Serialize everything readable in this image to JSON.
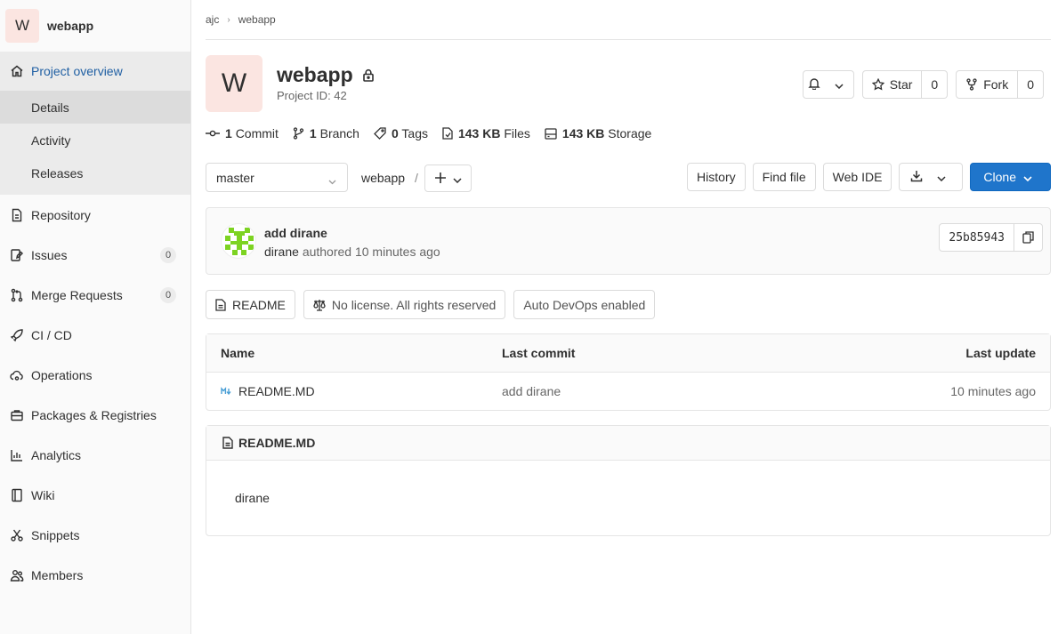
{
  "sidebar": {
    "project_initial": "W",
    "project_name": "webapp",
    "overview_label": "Project overview",
    "sub_items": [
      "Details",
      "Activity",
      "Releases"
    ],
    "items": [
      {
        "label": "Repository"
      },
      {
        "label": "Issues",
        "count": "0"
      },
      {
        "label": "Merge Requests",
        "count": "0"
      },
      {
        "label": "CI / CD"
      },
      {
        "label": "Operations"
      },
      {
        "label": "Packages & Registries"
      },
      {
        "label": "Analytics"
      },
      {
        "label": "Wiki"
      },
      {
        "label": "Snippets"
      },
      {
        "label": "Members"
      }
    ]
  },
  "breadcrumb": [
    "ajc",
    "webapp"
  ],
  "header": {
    "initial": "W",
    "title": "webapp",
    "project_id": "Project ID: 42",
    "star_label": "Star",
    "star_count": "0",
    "fork_label": "Fork",
    "fork_count": "0"
  },
  "stats": {
    "commits_num": "1",
    "commits_label": "Commit",
    "branches_num": "1",
    "branches_label": "Branch",
    "tags_num": "0",
    "tags_label": "Tags",
    "files_num": "143 KB",
    "files_label": "Files",
    "storage_num": "143 KB",
    "storage_label": "Storage"
  },
  "toolbar": {
    "branch": "master",
    "path": "webapp",
    "path_sep": "/",
    "history": "History",
    "find_file": "Find file",
    "web_ide": "Web IDE",
    "clone": "Clone"
  },
  "commit": {
    "title": "add dirane",
    "author": "dirane",
    "meta": "authored 10 minutes ago",
    "sha": "25b85943"
  },
  "badges": {
    "readme": "README",
    "license": "No license. All rights reserved",
    "devops": "Auto DevOps enabled"
  },
  "tree": {
    "headers": {
      "name": "Name",
      "last_commit": "Last commit",
      "last_update": "Last update"
    },
    "rows": [
      {
        "name": "README.MD",
        "commit": "add dirane",
        "update": "10 minutes ago"
      }
    ]
  },
  "readme": {
    "title": "README.MD",
    "content": "dirane"
  },
  "colors": {
    "primary": "#1f75cb",
    "avatar_bg": "#fbe5e1",
    "identicon": "#7dd322"
  }
}
